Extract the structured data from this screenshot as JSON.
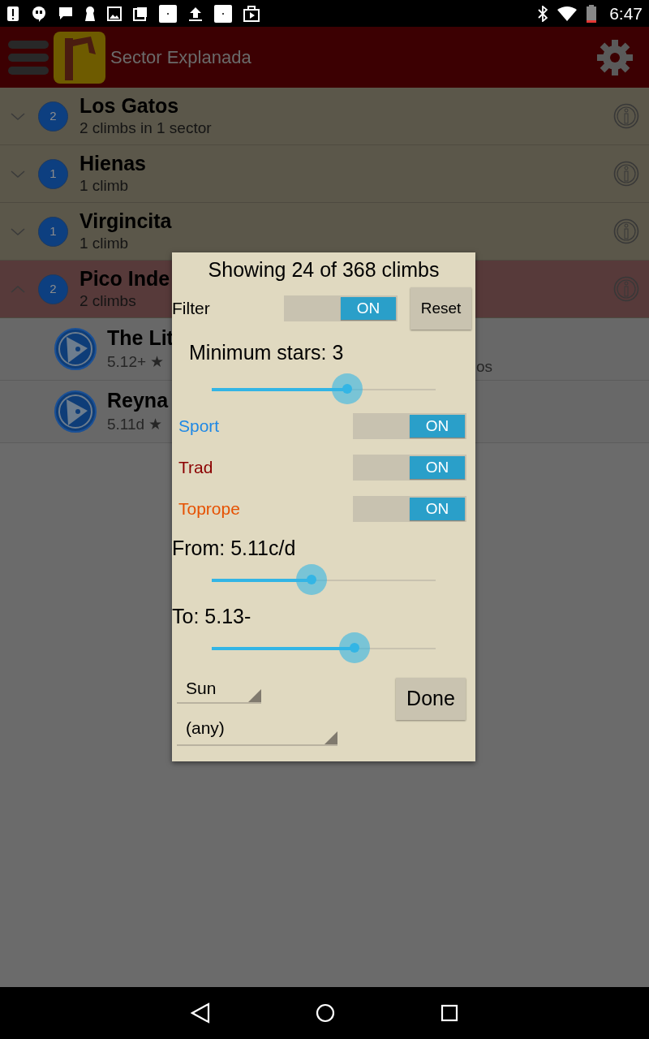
{
  "status_bar": {
    "time": "6:47"
  },
  "app_bar": {
    "title": "Sector Explanada"
  },
  "areas": [
    {
      "name": "Los Gatos",
      "count": "2",
      "subtitle": "2 climbs in 1 sector",
      "expanded": false
    },
    {
      "name": "Hienas",
      "count": "1",
      "subtitle": "1 climb",
      "expanded": false
    },
    {
      "name": "Virgincita",
      "count": "1",
      "subtitle": "1 climb",
      "expanded": false
    },
    {
      "name": "Pico Inde",
      "count": "2",
      "subtitle": "2 climbs",
      "expanded": true
    }
  ],
  "climbs": [
    {
      "name": "The Lit",
      "meta": "5.12+ ★",
      "meta_tail": "os"
    },
    {
      "name": "Reyna",
      "meta": "5.11d ★"
    }
  ],
  "dialog": {
    "title": "Showing 24 of 368 climbs",
    "filter": {
      "label": "Filter",
      "on": true,
      "toggle_text": "ON"
    },
    "reset_button": "Reset",
    "stars_slider": {
      "label": "Minimum stars: 3",
      "level": 0.605
    },
    "types": [
      {
        "label": "Sport",
        "color": "#1e88e5",
        "on": true,
        "toggle_text": "ON"
      },
      {
        "label": "Trad",
        "color": "#8b0000",
        "on": true,
        "toggle_text": "ON"
      },
      {
        "label": "Toprope",
        "color": "#e65100",
        "on": true,
        "toggle_text": "ON"
      }
    ],
    "from_slider": {
      "label": "From: 5.11c/d",
      "level": 0.446
    },
    "to_slider": {
      "label": "To: 5.13-",
      "level": 0.638
    },
    "sun_dropdown": {
      "value": "Sun"
    },
    "any_dropdown": {
      "value": "(any)"
    },
    "done_button": "Done"
  }
}
